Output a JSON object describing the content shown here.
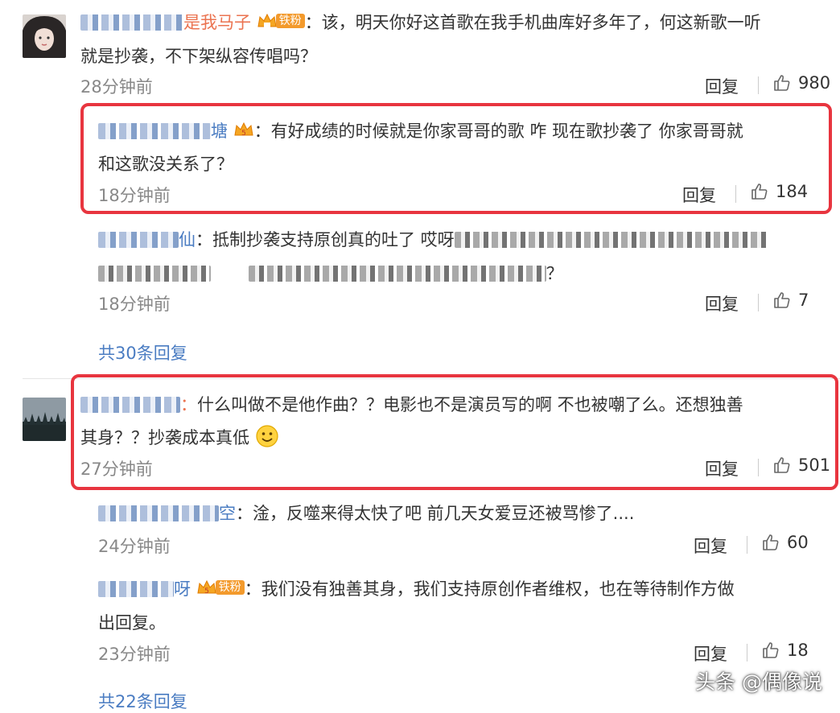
{
  "comments": [
    {
      "username_visible": "是我马子",
      "badge_level": "1",
      "badge_text": "铁粉",
      "text_line1": "：该，明天你好这首歌在我手机曲库好多年了，何这新歌一听",
      "text_line2": "就是抄袭，不下架纵容传唱吗？",
      "time": "28分钟前",
      "reply_label": "回复",
      "likes": "980"
    },
    {
      "username_visible": "：",
      "text_line1": "什么叫做不是他作曲？？电影也不是演员写的啊 不也被嘲了么。还想独善",
      "text_line2": "其身？？抄袭成本真低",
      "time": "27分钟前",
      "reply_label": "回复",
      "likes": "501"
    }
  ],
  "replies": [
    {
      "username_visible": "塘",
      "badge_level": "5",
      "text_line1": "：有好成绩的时候就是你家哥哥的歌 咋 现在歌抄袭了 你家哥哥就",
      "text_line2": "和这歌没关系了？",
      "time": "18分钟前",
      "reply_label": "回复",
      "likes": "184"
    },
    {
      "username_visible": "仙",
      "text_line1": "：抵制抄袭支持原创真的吐了 哎呀",
      "text_line2": "？",
      "time": "18分钟前",
      "reply_label": "回复",
      "likes": "7"
    },
    {
      "username_visible": "空",
      "text_line1": "：淦，反噬来得太快了吧 前几天女爱豆还被骂惨了....",
      "time": "24分钟前",
      "reply_label": "回复",
      "likes": "60"
    },
    {
      "username_visible": "呀",
      "badge_level": "5",
      "badge_text": "铁粉",
      "text_line1": "：我们没有独善其身，我们支持原创作者维权，也在等待制作方做",
      "text_line2": "出回复。",
      "time": "23分钟前",
      "reply_label": "回复",
      "likes": "18"
    }
  ],
  "more_replies": [
    "共30条回复",
    "共22条回复"
  ],
  "watermark": "头条 @偶像说",
  "colors": {
    "username": "#eb7350",
    "link": "#4a7cc2",
    "highlight": "#e8353f",
    "meta": "#888888"
  }
}
